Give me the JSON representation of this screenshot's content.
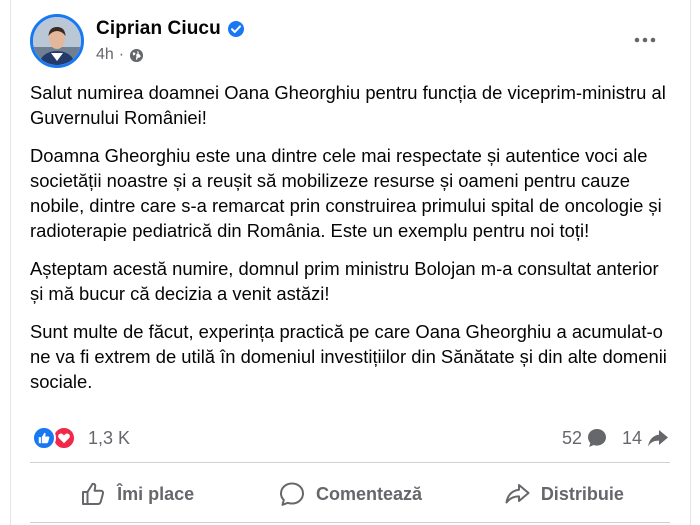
{
  "post": {
    "author": "Ciprian Ciucu",
    "time": "4h",
    "separator": "·",
    "paragraphs": [
      "Salut numirea doamnei Oana Gheorghiu pentru funcția de viceprim-ministru al Guvernului României!",
      "Doamna Gheorghiu este una dintre cele mai respectate și autentice voci ale societății noastre și a reușit să mobilizeze resurse și oameni pentru cauze nobile, dintre care s-a remarcat prin construirea primului spital de oncologie și radioterapie pediatrică din România. Este un exemplu pentru noi toți!",
      "Așteptam acestă numire, domnul prim ministru Bolojan m-a consultat anterior și mă bucur că decizia a venit astăzi!",
      "Sunt multe de făcut, experința practică pe care Oana Gheorghiu a acumulat-o ne va fi extrem de utilă în domeniul investițiilor din Sănătate și din alte domenii sociale."
    ]
  },
  "stats": {
    "reactions": "1,3 K",
    "comments": "52",
    "shares": "14"
  },
  "actions": {
    "like": "Îmi place",
    "comment": "Comentează",
    "share": "Distribuie"
  },
  "icons": {
    "verified": "verified-badge-icon",
    "audience": "globe-icon",
    "more": "more-options-icon",
    "like_reaction": "like-reaction-icon",
    "love_reaction": "love-reaction-icon",
    "comment": "comment-icon",
    "share": "share-icon"
  },
  "colors": {
    "brand_blue": "#1877f2",
    "love_red": "#f02849",
    "secondary_text": "#65676b"
  }
}
